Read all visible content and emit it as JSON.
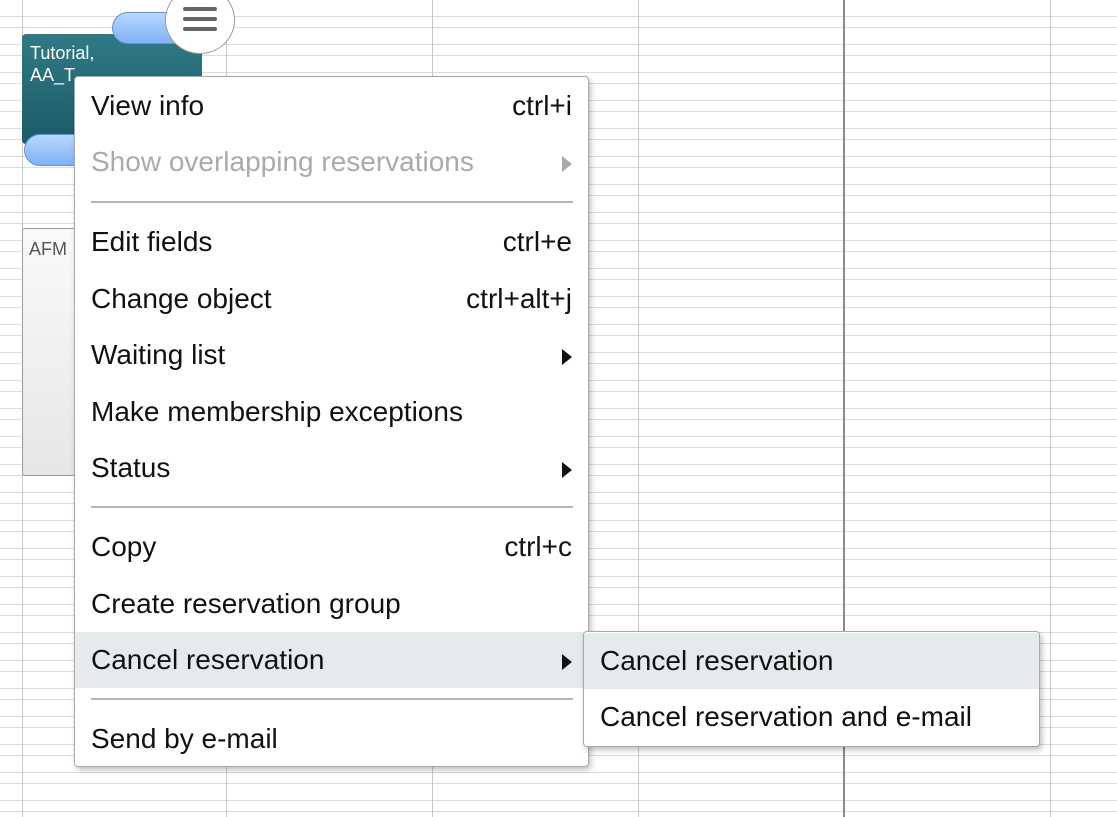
{
  "reservations": {
    "teal_block": {
      "line1": "Tutorial,",
      "line2": "AA_T..."
    },
    "gray_block": {
      "label": "AFM"
    }
  },
  "context_menu": {
    "items": [
      {
        "label": "View info",
        "shortcut": "ctrl+i"
      },
      {
        "label": "Show overlapping reservations",
        "disabled": true,
        "has_submenu": true
      },
      {
        "label": "Edit fields",
        "shortcut": "ctrl+e"
      },
      {
        "label": "Change object",
        "shortcut": "ctrl+alt+j"
      },
      {
        "label": "Waiting list",
        "has_submenu": true
      },
      {
        "label": "Make membership exceptions"
      },
      {
        "label": "Status",
        "has_submenu": true
      },
      {
        "label": "Copy",
        "shortcut": "ctrl+c"
      },
      {
        "label": "Create reservation group"
      },
      {
        "label": "Cancel reservation",
        "has_submenu": true,
        "highlighted": true
      },
      {
        "label": "Send by e-mail"
      }
    ]
  },
  "submenu": {
    "items": [
      {
        "label": "Cancel reservation",
        "highlighted": true
      },
      {
        "label": "Cancel reservation and e-mail"
      }
    ]
  },
  "colors": {
    "teal_block": "#1c5a66",
    "handle_blue": "#7fb2f5",
    "menu_hover": "#e5eaec",
    "disabled_text": "#aaaaaa"
  },
  "icons": {
    "menu_toggle": "hamburger-icon",
    "submenu_arrow": "triangle-right-icon"
  }
}
